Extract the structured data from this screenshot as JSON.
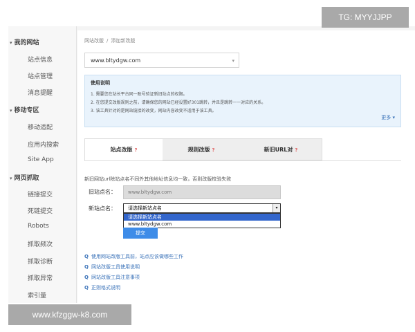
{
  "watermarks": {
    "top_right": "TG: MYYJJPP",
    "bottom_left": "www.kfzggw-k8.com"
  },
  "sidebar": {
    "sections": [
      {
        "label": "我的网站",
        "items": [
          "站点信息",
          "站点管理",
          "消息提醒"
        ]
      },
      {
        "label": "移动专区",
        "items": [
          "移动适配",
          "应用内搜索",
          "Site App"
        ]
      },
      {
        "label": "网页抓取",
        "items": [
          "链接提交",
          "死链提交",
          "Robots",
          "抓取频次",
          "抓取诊断",
          "抓取异常",
          "索引量"
        ]
      }
    ]
  },
  "breadcrumb": {
    "first": "网站改版",
    "sep": "/",
    "second": "添加新改版"
  },
  "site_selector": {
    "value": "www.bltydgw.com",
    "caret": "▾"
  },
  "info": {
    "title": "使用说明",
    "lines": [
      "1. 需要您在站长平台同一账号验证新旧站点的权限。",
      "2. 在您提交改版规则之前，请确保您的网站已经设置好301跳转，并且是跳转一一对应的关系。",
      "3. 该工具针对的是网站链接的改变，网站内容改变不适用于该工具。"
    ],
    "more": "更多 ▾"
  },
  "tabs": [
    {
      "label": "站点改版",
      "q": "?",
      "active": true
    },
    {
      "label": "规则改版",
      "q": "?",
      "active": false
    },
    {
      "label": "新旧URL对",
      "q": "?",
      "active": false
    }
  ],
  "form": {
    "notice": "新旧网站url除站点名不同外其他地址信息均一致，否则改版校验失败",
    "old_label": "旧站点名：",
    "old_value": "www.bltydgw.com",
    "new_label": "新站点名：",
    "new_value": "请选择新站点名",
    "caret": "▾",
    "options": [
      "请选择新站点名",
      "www.bltydgw.com"
    ],
    "submit": "提交"
  },
  "help_links": [
    "使用网站改版工具前，站点应该做哪些工作",
    "网站改版工具使用说明",
    "网站改版工具注意事项",
    "正则格式说明"
  ],
  "help_icon": "Q"
}
